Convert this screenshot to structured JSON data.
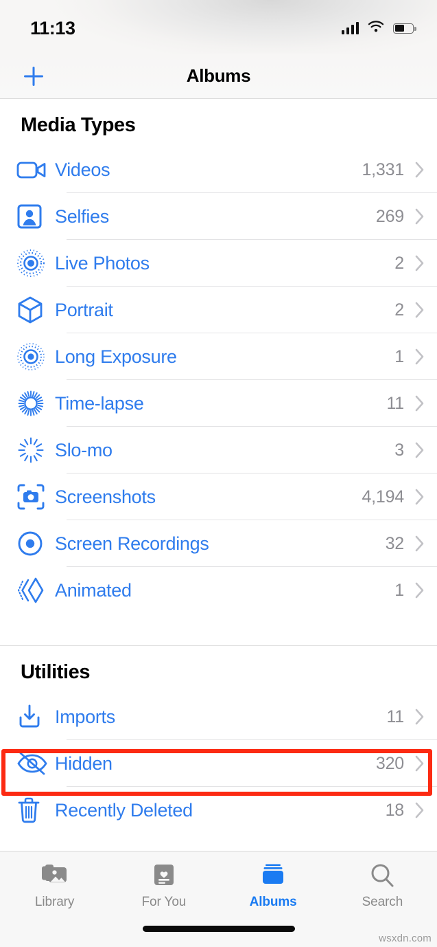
{
  "status_bar": {
    "time": "11:13",
    "cellular_icon": "signal-bars-icon",
    "wifi_icon": "wifi-icon",
    "battery_icon": "battery-icon",
    "battery_level_percent": 55
  },
  "nav_bar": {
    "add_icon": "plus-icon",
    "title": "Albums"
  },
  "sections": [
    {
      "title": "Media Types",
      "rows": [
        {
          "icon": "video-camera-icon",
          "label": "Videos",
          "count": "1,331",
          "chevron": "chevron-right-icon"
        },
        {
          "icon": "person-portrait-icon",
          "label": "Selfies",
          "count": "269",
          "chevron": "chevron-right-icon"
        },
        {
          "icon": "live-photo-icon",
          "label": "Live Photos",
          "count": "2",
          "chevron": "chevron-right-icon"
        },
        {
          "icon": "cube-icon",
          "label": "Portrait",
          "count": "2",
          "chevron": "chevron-right-icon"
        },
        {
          "icon": "long-exposure-icon",
          "label": "Long Exposure",
          "count": "1",
          "chevron": "chevron-right-icon"
        },
        {
          "icon": "timelapse-icon",
          "label": "Time-lapse",
          "count": "11",
          "chevron": "chevron-right-icon"
        },
        {
          "icon": "slomo-icon",
          "label": "Slo-mo",
          "count": "3",
          "chevron": "chevron-right-icon"
        },
        {
          "icon": "screenshot-icon",
          "label": "Screenshots",
          "count": "4,194",
          "chevron": "chevron-right-icon"
        },
        {
          "icon": "screen-recording-icon",
          "label": "Screen Recordings",
          "count": "32",
          "chevron": "chevron-right-icon"
        },
        {
          "icon": "animated-icon",
          "label": "Animated",
          "count": "1",
          "chevron": "chevron-right-icon"
        }
      ]
    },
    {
      "title": "Utilities",
      "rows": [
        {
          "icon": "import-icon",
          "label": "Imports",
          "count": "11",
          "chevron": "chevron-right-icon"
        },
        {
          "icon": "eye-slash-icon",
          "label": "Hidden",
          "count": "320",
          "chevron": "chevron-right-icon"
        },
        {
          "icon": "trash-icon",
          "label": "Recently Deleted",
          "count": "18",
          "chevron": "chevron-right-icon"
        }
      ]
    }
  ],
  "highlight": {
    "target_label": "Hidden",
    "color": "#fc2a12"
  },
  "tab_bar": {
    "tabs": [
      {
        "icon": "photos-library-icon",
        "label": "Library",
        "active": false
      },
      {
        "icon": "for-you-card-icon",
        "label": "For You",
        "active": false
      },
      {
        "icon": "albums-stack-icon",
        "label": "Albums",
        "active": true
      },
      {
        "icon": "magnifier-icon",
        "label": "Search",
        "active": false
      }
    ]
  },
  "watermark": "wsxdn.com",
  "colors": {
    "accent_blue": "#2f7ced",
    "tab_active_blue": "#1a7bf2",
    "count_gray": "#8e8e93",
    "highlight_red": "#fc2a12"
  }
}
